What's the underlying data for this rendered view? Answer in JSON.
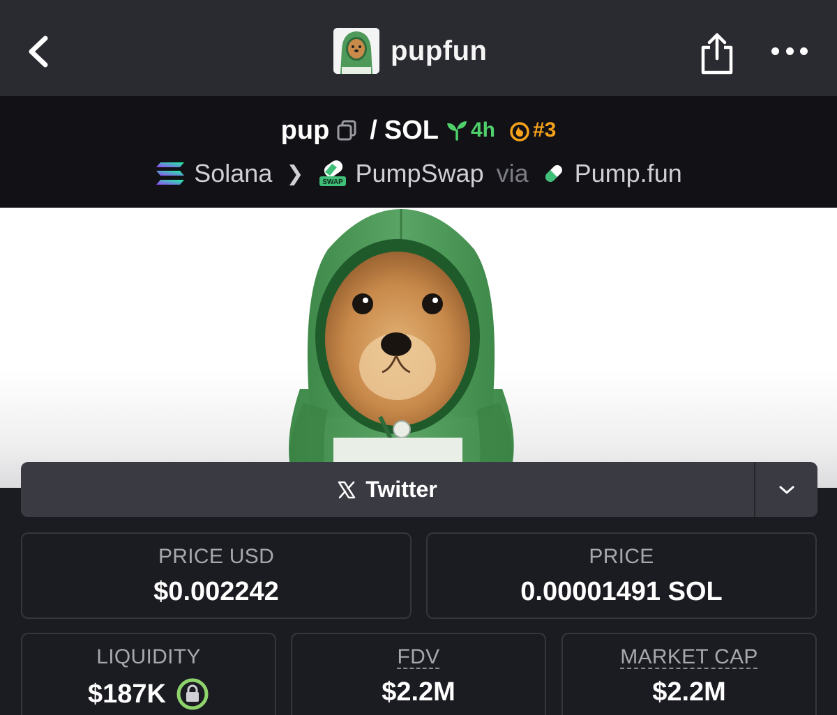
{
  "header": {
    "title": "pupfun"
  },
  "pair": {
    "base": "pup",
    "separator": "/",
    "quote": "SOL",
    "age": "4h",
    "rank": "#3"
  },
  "chain": {
    "chain_name": "Solana",
    "dex_name": "PumpSwap",
    "via_label": "via",
    "launchpad": "Pump.fun",
    "swap_icon_text": "SWAP"
  },
  "socials": {
    "twitter_label": "Twitter"
  },
  "stats": {
    "price_usd_label": "PRICE USD",
    "price_usd_value": "$0.002242",
    "price_label": "PRICE",
    "price_value": "0.00001491 SOL",
    "liquidity_label": "LIQUIDITY",
    "liquidity_value": "$187K",
    "fdv_label": "FDV",
    "fdv_value": "$2.2M",
    "market_cap_label": "MARKET CAP",
    "market_cap_value": "$2.2M"
  },
  "colors": {
    "topbar": "#2a2a31",
    "pairbar": "#111116",
    "age_green": "#4fd06b",
    "rank_orange": "#f7a21b",
    "lock_green": "#8ed36b"
  },
  "icons": [
    "back-icon",
    "share-icon",
    "more-icon",
    "copy-icon",
    "seedling-icon",
    "flame-icon",
    "solana-icon",
    "pumpswap-icon",
    "pill-icon",
    "x-icon",
    "chevron-down-icon",
    "lock-icon"
  ]
}
